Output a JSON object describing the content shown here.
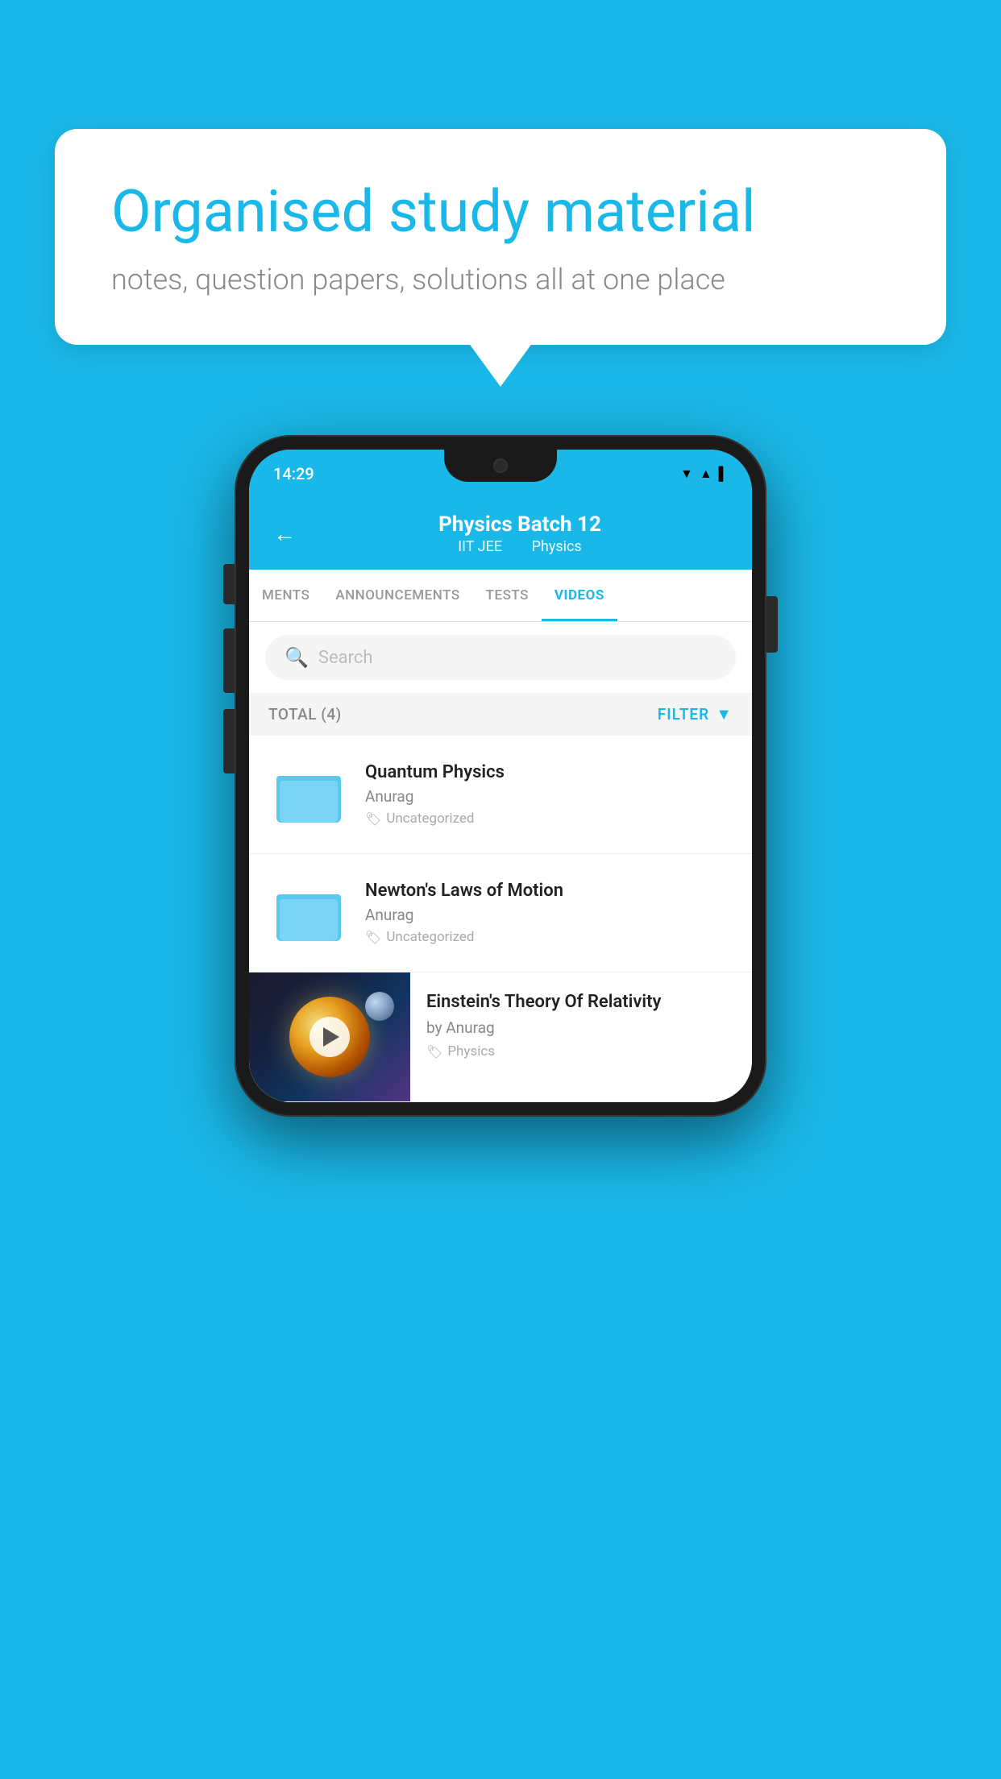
{
  "background": {
    "color": "#1ab8e8"
  },
  "speech_bubble": {
    "title": "Organised study material",
    "subtitle": "notes, question papers, solutions all at one place"
  },
  "phone": {
    "status_bar": {
      "time": "14:29",
      "icons": [
        "wifi",
        "signal",
        "battery"
      ]
    },
    "header": {
      "back_label": "←",
      "title": "Physics Batch 12",
      "subtitle_part1": "IIT JEE",
      "subtitle_part2": "Physics"
    },
    "tabs": [
      {
        "label": "MENTS",
        "active": false
      },
      {
        "label": "ANNOUNCEMENTS",
        "active": false
      },
      {
        "label": "TESTS",
        "active": false
      },
      {
        "label": "VIDEOS",
        "active": true
      }
    ],
    "search": {
      "placeholder": "Search"
    },
    "filter": {
      "total_label": "TOTAL (4)",
      "filter_label": "FILTER"
    },
    "videos": [
      {
        "id": 1,
        "type": "folder",
        "title": "Quantum Physics",
        "author": "Anurag",
        "tag": "Uncategorized"
      },
      {
        "id": 2,
        "type": "folder",
        "title": "Newton's Laws of Motion",
        "author": "Anurag",
        "tag": "Uncategorized"
      },
      {
        "id": 3,
        "type": "thumbnail",
        "title": "Einstein's Theory Of Relativity",
        "author": "by Anurag",
        "tag": "Physics"
      }
    ]
  }
}
